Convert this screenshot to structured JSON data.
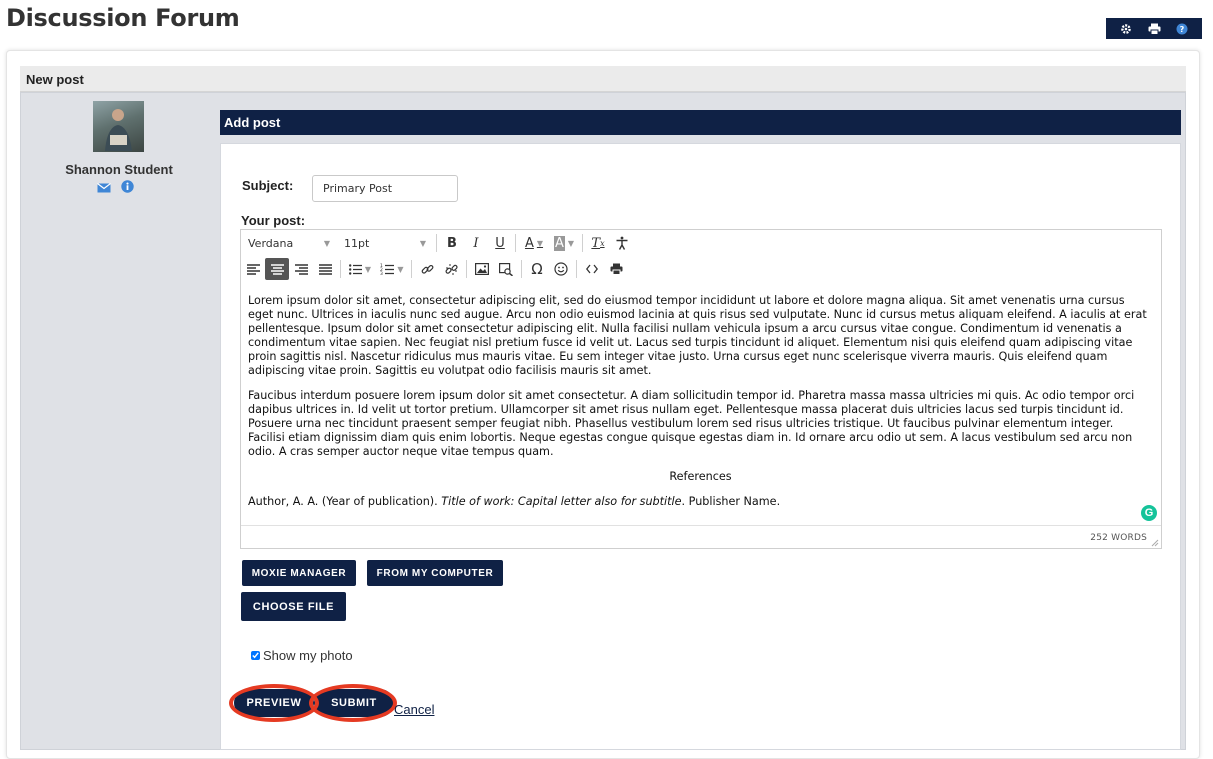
{
  "page": {
    "title": "Discussion Forum"
  },
  "top_tools": [
    "gear-icon",
    "print-icon",
    "help-icon"
  ],
  "new_post_bar": {
    "label": "New post"
  },
  "user": {
    "name": "Shannon Student",
    "icons": [
      "email-icon",
      "info-icon"
    ]
  },
  "add_post": {
    "header": "Add post",
    "subject_label": "Subject:",
    "subject_value": "Primary Post",
    "your_post_label": "Your post:"
  },
  "editor": {
    "font_family": "Verdana",
    "font_size": "11pt",
    "paragraphs": [
      "Lorem ipsum dolor sit amet, consectetur adipiscing elit, sed do eiusmod tempor incididunt ut labore et dolore magna aliqua. Sit amet venenatis urna cursus eget nunc. Ultrices in iaculis nunc sed augue. Arcu non odio euismod lacinia at quis risus sed vulputate. Nunc id cursus metus aliquam eleifend. A iaculis at erat pellentesque. Ipsum dolor sit amet consectetur adipiscing elit. Nulla facilisi nullam vehicula ipsum a arcu cursus vitae congue. Condimentum id venenatis a condimentum vitae sapien. Nec feugiat nisl pretium fusce id velit ut. Lacus sed turpis tincidunt id aliquet. Elementum nisi quis eleifend quam adipiscing vitae proin sagittis nisl. Nascetur ridiculus mus mauris vitae. Eu sem integer vitae justo. Urna cursus eget nunc scelerisque viverra mauris. Quis eleifend quam adipiscing vitae proin. Sagittis eu volutpat odio facilisis mauris sit amet.",
      "Faucibus interdum posuere lorem ipsum dolor sit amet consectetur. A diam sollicitudin tempor id. Pharetra massa massa ultricies mi quis. Ac odio tempor orci dapibus ultrices in. Id velit ut tortor pretium. Ullamcorper sit amet risus nullam eget. Pellentesque massa placerat duis ultricies lacus sed turpis tincidunt id. Posuere urna nec tincidunt praesent semper feugiat nibh. Phasellus vestibulum lorem sed risus ultricies tristique. Ut faucibus pulvinar elementum integer. Facilisi etiam dignissim diam quis enim lobortis. Neque egestas congue quisque egestas diam in. Id ornare arcu odio ut sem. A lacus vestibulum sed arcu non odio. A cras semper auctor neque vitae tempus quam."
    ],
    "references_heading": "References",
    "reference": {
      "prefix": "Author, A. A. (Year of publication). ",
      "title": "Title of work: Capital letter also for subtitle",
      "suffix": ". Publisher Name."
    },
    "word_count": "252 WORDS"
  },
  "buttons": {
    "moxie_manager": "MOXIE MANAGER",
    "from_my_computer": "FROM MY COMPUTER",
    "choose_file": "CHOOSE FILE",
    "preview": "PREVIEW",
    "submit": "SUBMIT",
    "cancel": "Cancel"
  },
  "show_photo": {
    "label": "Show my photo",
    "checked": true
  },
  "colors": {
    "navy": "#0f2145",
    "highlight_ring": "#e53a22",
    "panel_grey": "#dfe1e6"
  }
}
